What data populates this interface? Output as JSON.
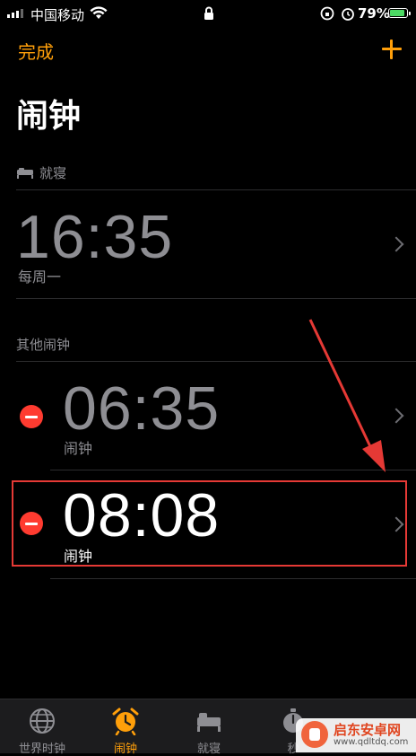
{
  "status_bar": {
    "carrier": "中国移动",
    "battery_percent": "79%"
  },
  "header": {
    "done_label": "完成",
    "title": "闹钟"
  },
  "sleep_section": {
    "title": "就寝",
    "alarm": {
      "time": "16:35",
      "repeat": "每周一"
    }
  },
  "other_section": {
    "title": "其他闹钟",
    "alarms": [
      {
        "time": "06:35",
        "label": "闹钟",
        "enabled": false
      },
      {
        "time": "08:08",
        "label": "闹钟",
        "enabled": true
      }
    ]
  },
  "tabbar": {
    "tabs": [
      {
        "label": "世界时钟",
        "icon": "globe-icon"
      },
      {
        "label": "闹钟",
        "icon": "alarm-clock-icon",
        "active": true
      },
      {
        "label": "就寝",
        "icon": "bed-icon"
      },
      {
        "label": "秒",
        "icon": "stopwatch-icon"
      }
    ]
  },
  "watermark": {
    "title": "启东安卓网",
    "url": "www.qdltdq.com"
  },
  "colors": {
    "accent": "#ff9f0a",
    "delete": "#ff3b30",
    "highlight_box": "#e53935",
    "arrow": "#e53935"
  }
}
